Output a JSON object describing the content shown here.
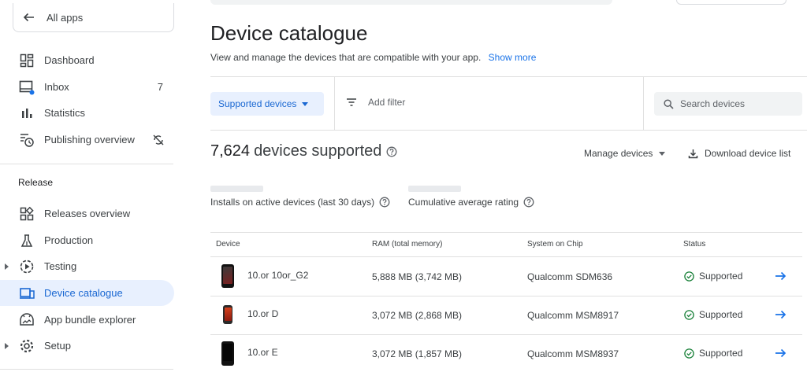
{
  "sidebar": {
    "all_apps": "All apps",
    "items": [
      {
        "label": "Dashboard",
        "icon": "dashboard-icon"
      },
      {
        "label": "Inbox",
        "icon": "inbox-icon",
        "badge": "7"
      },
      {
        "label": "Statistics",
        "icon": "statistics-icon"
      },
      {
        "label": "Publishing overview",
        "icon": "publishing-overview-icon",
        "trail_icon": "sync-disabled-icon"
      }
    ],
    "release_section": "Release",
    "release_items": [
      {
        "label": "Releases overview",
        "icon": "releases-overview-icon"
      },
      {
        "label": "Production",
        "icon": "production-icon"
      },
      {
        "label": "Testing",
        "icon": "testing-icon",
        "expandable": true
      },
      {
        "label": "Device catalogue",
        "icon": "device-catalogue-icon",
        "active": true
      },
      {
        "label": "App bundle explorer",
        "icon": "app-bundle-icon"
      },
      {
        "label": "Setup",
        "icon": "setup-gear-icon",
        "expandable": true
      }
    ]
  },
  "main": {
    "title": "Device catalogue",
    "subtitle": "View and manage the devices that are compatible with your app.",
    "show_more": "Show more",
    "filter_chip": "Supported devices",
    "add_filter": "Add filter",
    "search_placeholder": "Search devices",
    "count_number": "7,624",
    "count_text": "devices supported",
    "manage_devices": "Manage devices",
    "download_list": "Download device list",
    "metric_installs": "Installs on active devices (last 30 days)",
    "metric_rating": "Cumulative average rating"
  },
  "table": {
    "headers": {
      "device": "Device",
      "ram": "RAM (total memory)",
      "soc": "System on Chip",
      "status": "Status"
    },
    "rows": [
      {
        "device": "10.or 10or_G2",
        "ram": "5,888 MB (3,742 MB)",
        "soc": "Qualcomm SDM636",
        "status": "Supported"
      },
      {
        "device": "10.or D",
        "ram": "3,072 MB (2,868 MB)",
        "soc": "Qualcomm MSM8917",
        "status": "Supported"
      },
      {
        "device": "10.or E",
        "ram": "3,072 MB (1,857 MB)",
        "soc": "Qualcomm MSM8937",
        "status": "Supported"
      }
    ]
  },
  "colors": {
    "accent": "#1a73e8",
    "active_bg": "#e8f0fe",
    "success": "#188038"
  }
}
